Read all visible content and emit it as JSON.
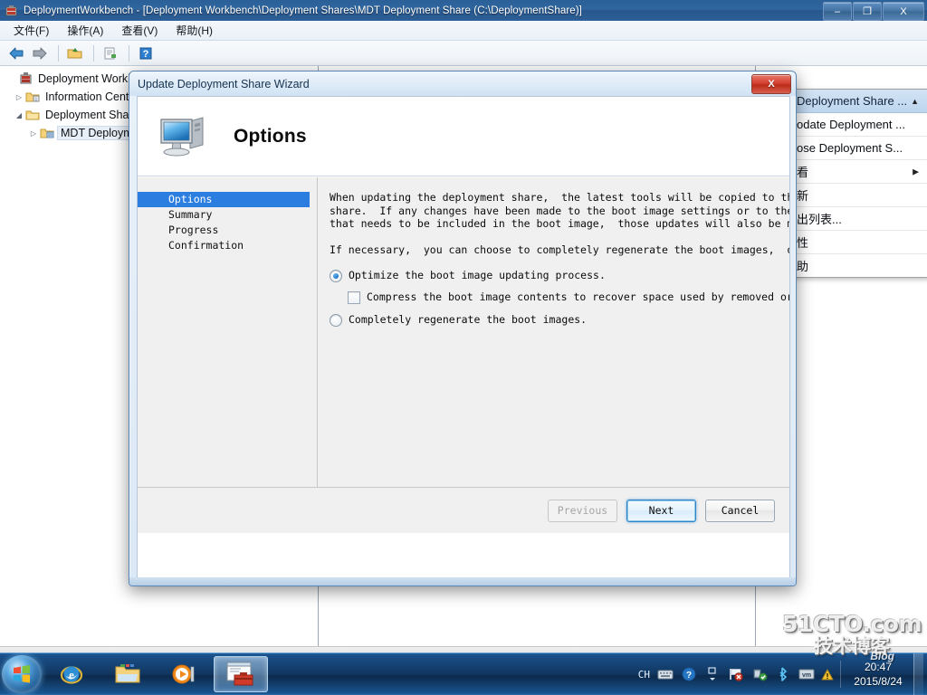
{
  "window": {
    "title": "DeploymentWorkbench - [Deployment Workbench\\Deployment Shares\\MDT Deployment Share (C:\\DeploymentShare)]",
    "app_icon": "mmc-console-icon",
    "controls": {
      "minimize": "–",
      "restore": "❐",
      "close": "X"
    }
  },
  "menubar": {
    "items": [
      {
        "label": "文件(F)",
        "name": "menu-file"
      },
      {
        "label": "操作(A)",
        "name": "menu-action"
      },
      {
        "label": "查看(V)",
        "name": "menu-view"
      },
      {
        "label": "帮助(H)",
        "name": "menu-help"
      }
    ]
  },
  "toolbar": {
    "buttons": [
      {
        "name": "back-button",
        "icon": "back-arrow-icon"
      },
      {
        "name": "forward-button",
        "icon": "forward-arrow-icon"
      },
      {
        "name": "up-folder-button",
        "icon": "folder-up-icon"
      },
      {
        "name": "properties-button",
        "icon": "document-properties-icon"
      },
      {
        "name": "help-button",
        "icon": "help-question-icon"
      }
    ]
  },
  "tree": {
    "items": [
      {
        "label": "Deployment Workbi",
        "indent": 0,
        "expander": "",
        "icon": "console-root-icon",
        "selected": false
      },
      {
        "label": "Information Cent",
        "indent": 1,
        "expander": "▷",
        "icon": "information-folder-icon",
        "selected": false
      },
      {
        "label": "Deployment Sha",
        "indent": 1,
        "expander": "◢",
        "icon": "shares-folder-icon",
        "selected": false
      },
      {
        "label": "MDT Deploym",
        "indent": 2,
        "expander": "▷",
        "icon": "deployment-share-icon",
        "selected": true
      }
    ]
  },
  "context_menu": {
    "items": [
      {
        "label": "Deployment Share ...",
        "name": "ctx-deployment-share-header",
        "header": true,
        "arrow": "▲"
      },
      {
        "label": "odate Deployment ...",
        "name": "ctx-update-deployment-share",
        "header": false,
        "arrow": ""
      },
      {
        "label": "ose Deployment S...",
        "name": "ctx-close-deployment-share",
        "header": false,
        "arrow": ""
      },
      {
        "label": "看",
        "name": "ctx-view",
        "header": false,
        "arrow": "▶"
      },
      {
        "label": "新",
        "name": "ctx-refresh",
        "header": false,
        "arrow": ""
      },
      {
        "label": "出列表...",
        "name": "ctx-export-list",
        "header": false,
        "arrow": ""
      },
      {
        "label": "性",
        "name": "ctx-properties",
        "header": false,
        "arrow": ""
      },
      {
        "label": "助",
        "name": "ctx-help",
        "header": false,
        "arrow": ""
      }
    ]
  },
  "dialog": {
    "title": "Update Deployment Share Wizard",
    "close_label": "X",
    "heading": "Options",
    "header_icon": "computer-monitor-icon",
    "steps": [
      {
        "label": "Options",
        "active": true
      },
      {
        "label": "Summary",
        "active": false
      },
      {
        "label": "Progress",
        "active": false
      },
      {
        "label": "Confirmation",
        "active": false
      }
    ],
    "paragraph1": "When updating the deployment share,  the latest tools will be copied to the deployment\nshare.  If any changes have been made to the boot image settings or to the content\nthat needs to be included in the boot image,  those updates will also be made.",
    "paragraph2": "If necessary,  you can choose to completely regenerate the boot images,  or to compress",
    "options": {
      "optimize": {
        "label": "Optimize the boot image updating process.",
        "checked": true
      },
      "compress": {
        "label": "Compress the boot image contents to recover space used by removed or modified co",
        "checked": false
      },
      "regenerate": {
        "label": "Completely regenerate the boot images.",
        "checked": false
      }
    },
    "buttons": {
      "previous": "Previous",
      "next": "Next",
      "cancel": "Cancel"
    }
  },
  "taskbar": {
    "start_label": "start-orb",
    "items": [
      {
        "name": "taskbar-internet-explorer",
        "icon": "internet-explorer-icon",
        "active": false
      },
      {
        "name": "taskbar-windows-explorer",
        "icon": "folder-explorer-icon",
        "active": false
      },
      {
        "name": "taskbar-media-player",
        "icon": "media-player-icon",
        "active": false
      },
      {
        "name": "taskbar-deployment-workbench",
        "icon": "toolbox-window-icon",
        "active": true
      }
    ],
    "tray": {
      "ime": "CH",
      "icons": [
        {
          "name": "keyboard-icon",
          "glyph": "⌨"
        },
        {
          "name": "help-icon",
          "glyph": "?"
        },
        {
          "name": "show-hidden-icons-icon",
          "glyph": "▴"
        },
        {
          "name": "action-center-flag-icon",
          "glyph": "⚑"
        },
        {
          "name": "network-icon",
          "glyph": "▮"
        },
        {
          "name": "bluetooth-icon",
          "glyph": "✷"
        },
        {
          "name": "vmware-tray-icon",
          "glyph": "vm"
        },
        {
          "name": "warning-icon",
          "glyph": "⚠"
        }
      ],
      "clock_time": "20:47",
      "clock_date": "2015/8/24"
    }
  },
  "watermark": {
    "main": "51CTO.com",
    "sub": "技术博客",
    "blog": "Blog"
  }
}
